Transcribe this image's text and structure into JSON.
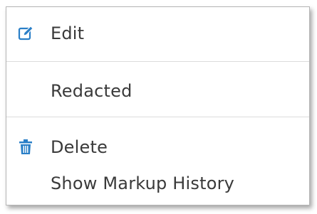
{
  "context_menu": {
    "items": [
      {
        "label": "Edit",
        "icon": "edit-icon",
        "icon_color": "#2a7fc7"
      },
      {
        "label": "Redacted"
      },
      {
        "label": "Delete",
        "icon": "trash-icon",
        "icon_color": "#2a7fc7"
      },
      {
        "label": "Show Markup History"
      }
    ]
  }
}
